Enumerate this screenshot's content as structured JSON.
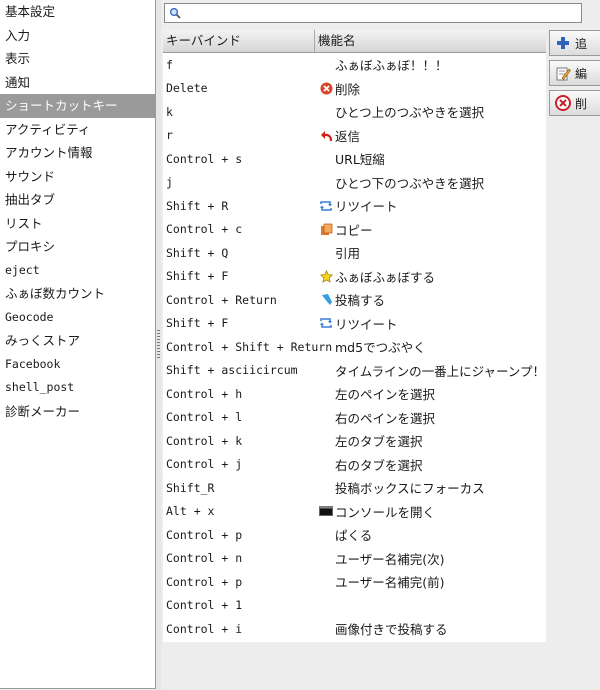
{
  "sidebar": {
    "items": [
      {
        "label": "基本設定"
      },
      {
        "label": "入力"
      },
      {
        "label": "表示"
      },
      {
        "label": "通知"
      },
      {
        "label": "ショートカットキー",
        "active": true
      },
      {
        "label": "アクティビティ"
      },
      {
        "label": "アカウント情報"
      },
      {
        "label": "サウンド"
      },
      {
        "label": "抽出タブ"
      },
      {
        "label": "リスト"
      },
      {
        "label": "プロキシ"
      },
      {
        "label": "eject"
      },
      {
        "label": "ふぁぼ数カウント"
      },
      {
        "label": "Geocode"
      },
      {
        "label": "みっくストア"
      },
      {
        "label": "Facebook"
      },
      {
        "label": "shell_post"
      },
      {
        "label": "診断メーカー"
      }
    ]
  },
  "search": {
    "value": "",
    "icon": "search-icon"
  },
  "table": {
    "headers": {
      "key": "キーバインド",
      "function": "機能名"
    },
    "rows": [
      {
        "key": "f",
        "icon": "",
        "function": "ふぁぼふぁぼ！！！"
      },
      {
        "key": "Delete",
        "icon": "delete-icon",
        "function": "削除"
      },
      {
        "key": "k",
        "icon": "",
        "function": "ひとつ上のつぶやきを選択"
      },
      {
        "key": "r",
        "icon": "reply-icon",
        "function": "返信"
      },
      {
        "key": "Control + s",
        "icon": "",
        "function": "URL短縮"
      },
      {
        "key": "j",
        "icon": "",
        "function": "ひとつ下のつぶやきを選択"
      },
      {
        "key": "Shift + R",
        "icon": "retweet-icon",
        "function": "リツイート"
      },
      {
        "key": "Control + c",
        "icon": "copy-icon",
        "function": "コピー"
      },
      {
        "key": "Shift + Q",
        "icon": "",
        "function": "引用"
      },
      {
        "key": "Shift + F",
        "icon": "star-icon",
        "function": "ふぁぼふぁぼする"
      },
      {
        "key": "Control + Return",
        "icon": "post-icon",
        "function": "投稿する"
      },
      {
        "key": "Shift + F",
        "icon": "retweet-icon",
        "function": "リツイート"
      },
      {
        "key": "Control + Shift + Return",
        "icon": "",
        "function": "md5でつぶやく"
      },
      {
        "key": "Shift + asciicircum",
        "icon": "",
        "function": "タイムラインの一番上にジャーンプ！"
      },
      {
        "key": "Control + h",
        "icon": "",
        "function": "左のペインを選択"
      },
      {
        "key": "Control + l",
        "icon": "",
        "function": "右のペインを選択"
      },
      {
        "key": "Control + k",
        "icon": "",
        "function": "左のタブを選択"
      },
      {
        "key": "Control + j",
        "icon": "",
        "function": "右のタブを選択"
      },
      {
        "key": "Shift_R",
        "icon": "",
        "function": "投稿ボックスにフォーカス"
      },
      {
        "key": "Alt + x",
        "icon": "console-icon",
        "function": "コンソールを開く"
      },
      {
        "key": "Control + p",
        "icon": "",
        "function": "ぱくる"
      },
      {
        "key": "Control + n",
        "icon": "",
        "function": "ユーザー名補完(次)"
      },
      {
        "key": "Control + p",
        "icon": "",
        "function": "ユーザー名補完(前)"
      },
      {
        "key": "Control + 1",
        "icon": "",
        "function": ""
      },
      {
        "key": "Control + i",
        "icon": "",
        "function": "画像付きで投稿する"
      }
    ]
  },
  "buttons": [
    {
      "label": "追",
      "icon": "add-icon"
    },
    {
      "label": "編",
      "icon": "edit-icon"
    },
    {
      "label": "削",
      "icon": "delete-icon"
    }
  ]
}
